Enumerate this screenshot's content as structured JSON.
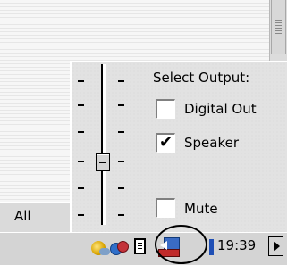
{
  "tab": {
    "label": "All"
  },
  "volume": {
    "title": "Select Output:",
    "options": [
      {
        "label": "Digital Out",
        "checked": false,
        "mark": ""
      },
      {
        "label": "Speaker",
        "checked": true,
        "mark": "✔"
      }
    ],
    "mute": {
      "label": "Mute",
      "checked": false,
      "mark": ""
    },
    "level": 0.2
  },
  "taskbar": {
    "clock": "19:39",
    "tray_icons": [
      "weather-icon",
      "network-icon",
      "clipboard-icon",
      "speaker-volume-icon"
    ],
    "expand_icon": "triangle-right-icon"
  }
}
